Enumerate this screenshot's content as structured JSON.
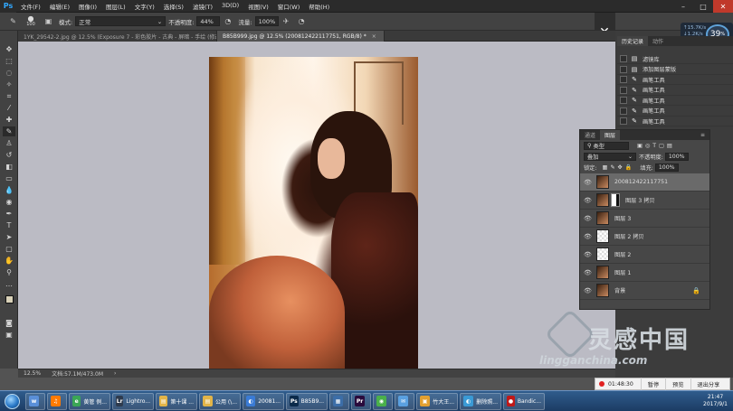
{
  "app": {
    "logo": "Ps"
  },
  "menu": [
    "文件(F)",
    "编辑(E)",
    "图像(I)",
    "图层(L)",
    "文字(Y)",
    "选择(S)",
    "滤镜(T)",
    "3D(D)",
    "视图(V)",
    "窗口(W)",
    "帮助(H)"
  ],
  "options": {
    "brush_size": "100",
    "mode_label": "模式:",
    "mode_value": "正常",
    "opacity_label": "不透明度:",
    "opacity_value": "44%",
    "flow_label": "流量:",
    "flow_value": "100%"
  },
  "tabs": [
    {
      "label": "1YK_29542-2.jpg @ 12.5% (Exposure 7 - 彩色胶片 - 古典 - 屏暗 - 手绘 (修改)",
      "active": false
    },
    {
      "label": "B85B999.jpg @ 12.5% (200812422117751, RGB/8) *",
      "active": true
    }
  ],
  "status": {
    "zoom": "12.5%",
    "doc": "文档:57.1M/473.0M"
  },
  "history": {
    "tabs": [
      "历史记录",
      "动作"
    ],
    "items": [
      "滤镜库",
      "添加图层蒙版",
      "画笔工具",
      "画笔工具",
      "画笔工具",
      "画笔工具",
      "画笔工具"
    ]
  },
  "perf": {
    "up": "15.7",
    "down": "1.2",
    "unit": "K/s",
    "value": "39",
    "suffix": "%"
  },
  "layers_panel": {
    "tabs": [
      "通道",
      "图层"
    ],
    "kind": "类型",
    "blend": "叠加",
    "opacity_label": "不透明度:",
    "opacity_value": "100%",
    "lock_label": "锁定:",
    "fill_label": "填充:",
    "fill_value": "100%",
    "layers": [
      {
        "name": "200812422117751",
        "selected": true,
        "thumb": "photo"
      },
      {
        "name": "图层 3 拷贝",
        "selected": false,
        "thumb": "photo",
        "mask": true
      },
      {
        "name": "图层 3",
        "selected": false,
        "thumb": "photo"
      },
      {
        "name": "图层 2 拷贝",
        "selected": false,
        "thumb": "trans"
      },
      {
        "name": "图层 2",
        "selected": false,
        "thumb": "trans"
      },
      {
        "name": "图层 1",
        "selected": false,
        "thumb": "photo"
      },
      {
        "name": "背景",
        "selected": false,
        "thumb": "photo",
        "locked": true
      }
    ]
  },
  "watermark": {
    "text": "灵感中国",
    "url": "lingganchina.com"
  },
  "bandicam": {
    "time": "01:48:30",
    "b1": "暂停",
    "b2": "预览",
    "b3": "退出分享"
  },
  "taskbar": {
    "items": [
      {
        "label": "",
        "icon": "w",
        "color": "#5a8fd8"
      },
      {
        "label": "",
        "icon": "♫",
        "color": "#ff7a00"
      },
      {
        "label": "黄管 例...",
        "icon": "e",
        "color": "#3aa655"
      },
      {
        "label": "Lightro...",
        "icon": "Lr",
        "color": "#2e3b4e"
      },
      {
        "label": "第十课 ...",
        "icon": "▤",
        "color": "#e2b448"
      },
      {
        "label": "公用 (\\...",
        "icon": "▤",
        "color": "#e2b448"
      },
      {
        "label": "20081...",
        "icon": "◐",
        "color": "#3a7bd5"
      },
      {
        "label": "B85B9...",
        "icon": "Ps",
        "color": "#0b2a4a"
      },
      {
        "label": "",
        "icon": "▦",
        "color": "#3c6ea8"
      },
      {
        "label": "",
        "icon": "Pr",
        "color": "#2a0b3c"
      },
      {
        "label": "",
        "icon": "◉",
        "color": "#4ab04a"
      },
      {
        "label": "",
        "icon": "✉",
        "color": "#5aa0e0"
      },
      {
        "label": "竹大王...",
        "icon": "▣",
        "color": "#e2a030"
      },
      {
        "label": "删除照...",
        "icon": "◐",
        "color": "#3a9ad5"
      },
      {
        "label": "Bandic...",
        "icon": "●",
        "color": "#c01818"
      }
    ],
    "time": "21:47",
    "date": "2017/9/1"
  }
}
